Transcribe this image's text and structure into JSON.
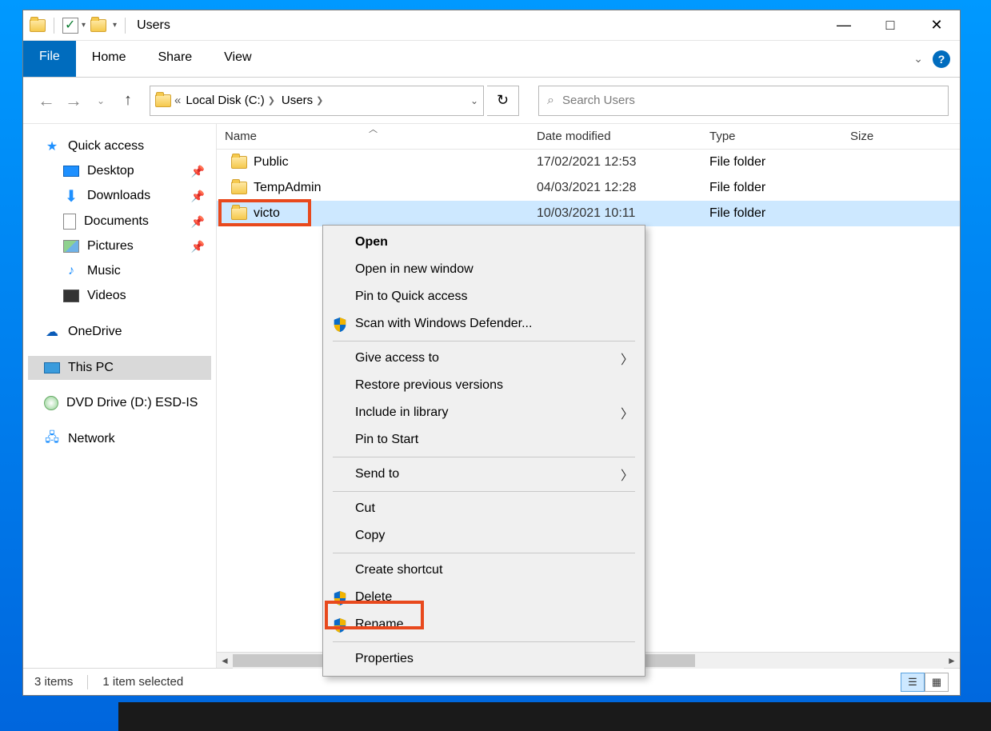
{
  "window": {
    "title": "Users"
  },
  "ribbon": {
    "file": "File",
    "tabs": [
      "Home",
      "Share",
      "View"
    ]
  },
  "address": {
    "crumb_prefix": "«",
    "crumbs": [
      "Local Disk (C:)",
      "Users"
    ]
  },
  "search": {
    "placeholder": "Search Users"
  },
  "nav": {
    "quick_access": "Quick access",
    "items": [
      {
        "label": "Desktop",
        "pin": true
      },
      {
        "label": "Downloads",
        "pin": true
      },
      {
        "label": "Documents",
        "pin": true
      },
      {
        "label": "Pictures",
        "pin": true
      },
      {
        "label": "Music",
        "pin": false
      },
      {
        "label": "Videos",
        "pin": false
      }
    ],
    "onedrive": "OneDrive",
    "this_pc": "This PC",
    "dvd": "DVD Drive (D:) ESD-IS",
    "network": "Network"
  },
  "columns": {
    "name": "Name",
    "date": "Date modified",
    "type": "Type",
    "size": "Size"
  },
  "rows": [
    {
      "name": "Public",
      "date": "17/02/2021 12:53",
      "type": "File folder"
    },
    {
      "name": "TempAdmin",
      "date": "04/03/2021 12:28",
      "type": "File folder"
    },
    {
      "name": "victo",
      "date": "10/03/2021 10:11",
      "type": "File folder",
      "selected": true
    }
  ],
  "context_menu": {
    "open": "Open",
    "open_new": "Open in new window",
    "pin_qa": "Pin to Quick access",
    "defender": "Scan with Windows Defender...",
    "give_access": "Give access to",
    "restore": "Restore previous versions",
    "include": "Include in library",
    "pin_start": "Pin to Start",
    "send_to": "Send to",
    "cut": "Cut",
    "copy": "Copy",
    "shortcut": "Create shortcut",
    "delete": "Delete",
    "rename": "Rename",
    "properties": "Properties"
  },
  "status": {
    "count": "3 items",
    "selected": "1 item selected"
  }
}
